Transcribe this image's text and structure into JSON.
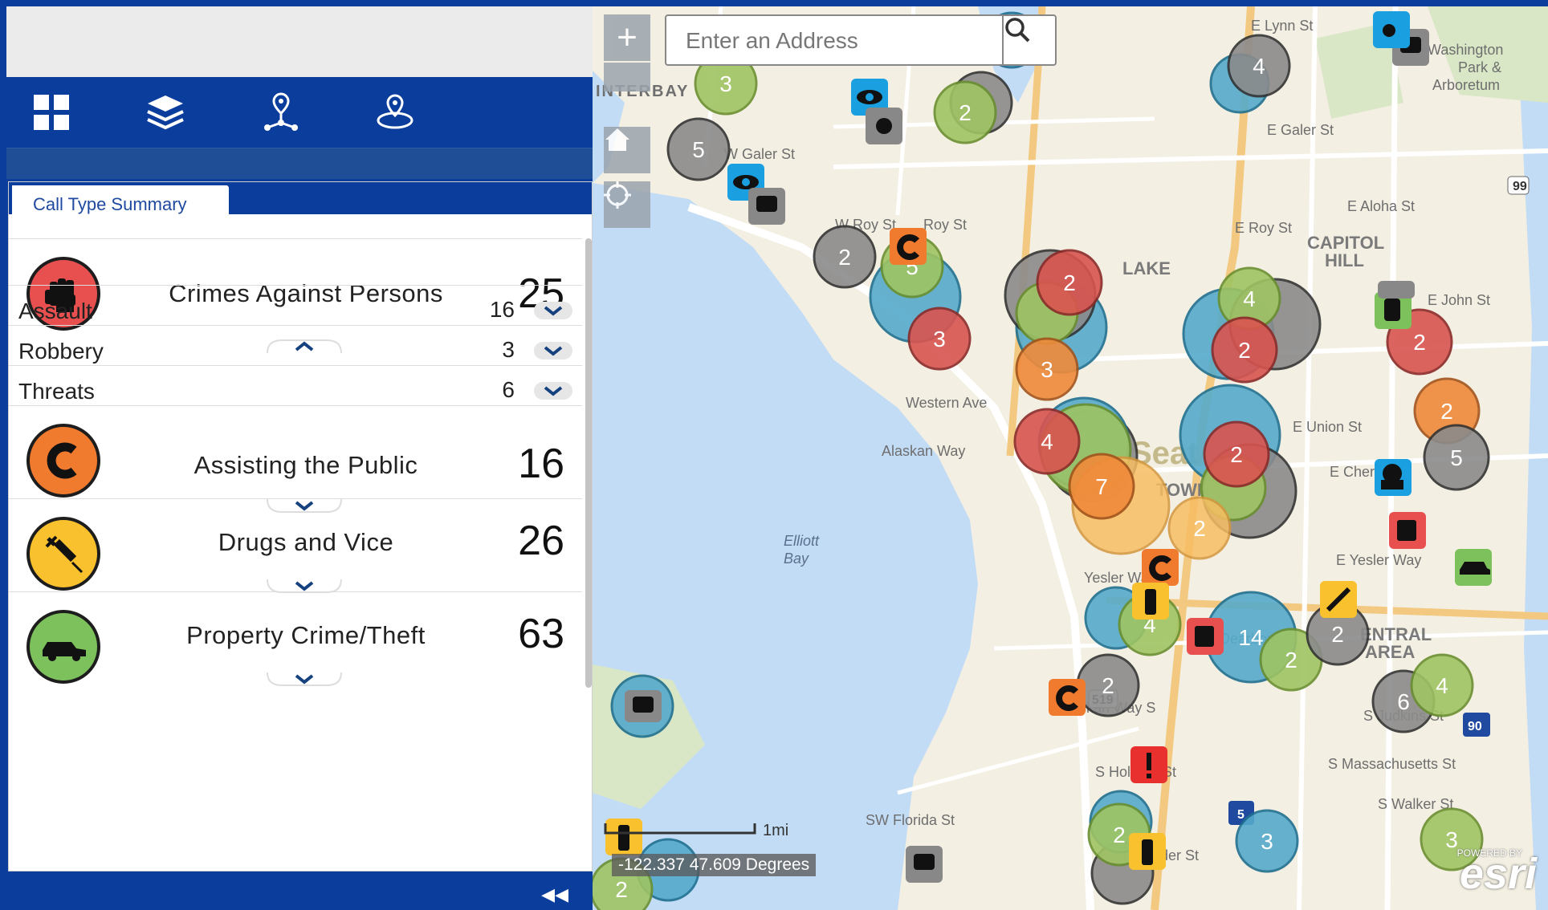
{
  "toolbar": {
    "buttons": [
      "grid-icon",
      "layers-icon",
      "location-network-icon",
      "location-radius-icon"
    ]
  },
  "panel": {
    "tab_label": "Call Type Summary",
    "categories": [
      {
        "name": "Crimes Against Persons",
        "count": "25",
        "color": "#e8504f",
        "icon": "fist-icon",
        "expanded": true,
        "subtypes": [
          {
            "label": "Assault",
            "count": "16"
          },
          {
            "label": "Robbery",
            "count": "3"
          },
          {
            "label": "Threats",
            "count": "6"
          }
        ]
      },
      {
        "name": "Assisting the Public",
        "count": "16",
        "color": "#f07a2e",
        "icon": "letter-c-icon",
        "expanded": false
      },
      {
        "name": "Drugs and Vice",
        "count": "26",
        "color": "#f9c12e",
        "icon": "syringe-icon",
        "expanded": false
      },
      {
        "name": "Property Crime/Theft",
        "count": "63",
        "color": "#7cc15b",
        "icon": "car-icon",
        "expanded": false
      }
    ]
  },
  "map": {
    "search_placeholder": "Enter an Address",
    "zoom_in": "+",
    "scale_label": "1mi",
    "coordinates": "-122.337 47.609 Degrees",
    "powered_by": "POWERED BY",
    "brand": "esri",
    "labels": [
      "INTERBAY",
      "W Galer St",
      "W Roy St",
      "Roy St",
      "E Lynn St",
      "E Galer St",
      "E Aloha St",
      "E Roy St",
      "CAPITOL HILL",
      "E John St",
      "Washington Park & Arboretum",
      "E Union St",
      "E Cherry St",
      "E Yesler Way",
      "ENTRAL AREA",
      "S Dearborn",
      "S Judkins St",
      "S Massachusetts St",
      "S Walker St",
      "SW Florida St",
      "Elliott Bay",
      "Yesler Way",
      "Seattle",
      "TOWN",
      "LAKE UNION",
      "Western Ave",
      "Alaskan Way",
      "Alaskan Way S",
      "S Holgate St",
      "S Lander St",
      "90",
      "5",
      "99",
      "519"
    ],
    "clusters": [
      {
        "n": "3",
        "c": "green"
      },
      {
        "n": "5",
        "c": "gray"
      },
      {
        "n": "2",
        "c": "green"
      },
      {
        "n": "2",
        "c": "blue"
      },
      {
        "n": "4",
        "c": "gray"
      },
      {
        "n": "2",
        "c": "gray"
      },
      {
        "n": "5",
        "c": "green"
      },
      {
        "n": "3",
        "c": "red"
      },
      {
        "n": "2",
        "c": "red"
      },
      {
        "n": "3",
        "c": "orange"
      },
      {
        "n": "4",
        "c": "green"
      },
      {
        "n": "2",
        "c": "red"
      },
      {
        "n": "2",
        "c": "red"
      },
      {
        "n": "2",
        "c": "orange"
      },
      {
        "n": "5",
        "c": "gray"
      },
      {
        "n": "4",
        "c": "red"
      },
      {
        "n": "7",
        "c": "orange"
      },
      {
        "n": "2",
        "c": "red"
      },
      {
        "n": "2",
        "c": "yellow"
      },
      {
        "n": "4",
        "c": "green"
      },
      {
        "n": "14",
        "c": "blue"
      },
      {
        "n": "2",
        "c": "green"
      },
      {
        "n": "2",
        "c": "gray"
      },
      {
        "n": "6",
        "c": "gray"
      },
      {
        "n": "4",
        "c": "green"
      },
      {
        "n": "2",
        "c": "gray"
      },
      {
        "n": "3",
        "c": "blue"
      },
      {
        "n": "3",
        "c": "green"
      },
      {
        "n": "2",
        "c": "green"
      },
      {
        "n": "2",
        "c": "gray"
      }
    ]
  }
}
